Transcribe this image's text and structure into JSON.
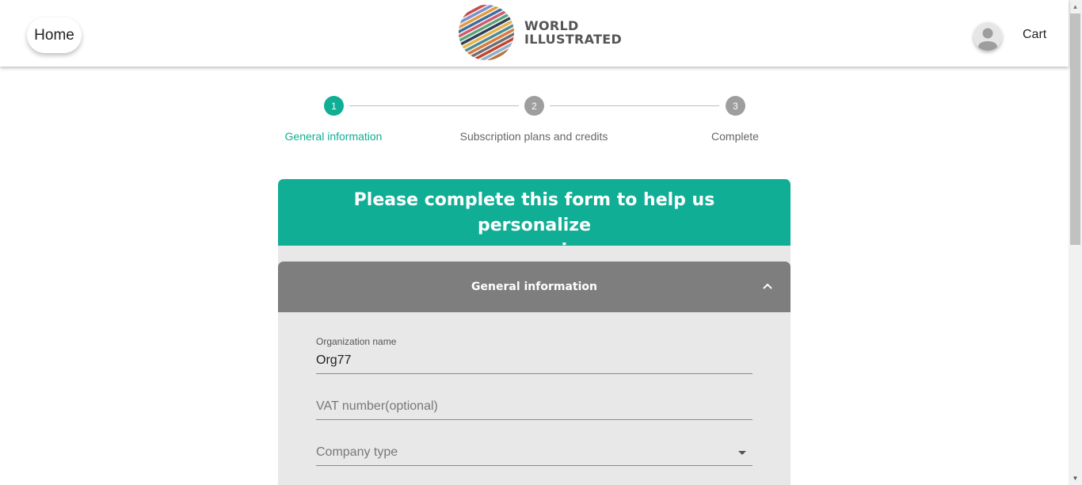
{
  "header": {
    "home_label": "Home",
    "logo_line1": "WORLD",
    "logo_line2": "ILLUSTRATED",
    "cart_label": "Cart"
  },
  "stepper": {
    "steps": [
      {
        "number": "1",
        "label": "General information",
        "active": true
      },
      {
        "number": "2",
        "label": "Subscription plans and credits",
        "active": false
      },
      {
        "number": "3",
        "label": "Complete",
        "active": false
      }
    ],
    "active_color": "#10ae95",
    "inactive_color": "#9e9e9e"
  },
  "banner": {
    "line1": "Please complete this form to help us personalize",
    "line2": "your experience",
    "color": "#10ae95"
  },
  "section": {
    "title": "General information",
    "color": "#7e7e7e"
  },
  "form": {
    "org_name_label": "Organization name",
    "org_name_value": "Org77",
    "vat_placeholder": "VAT number(optional)",
    "company_type_placeholder": "Company type"
  },
  "icons": {
    "avatar": "person-icon",
    "section_toggle": "chevron-up-icon",
    "select": "caret-down-icon"
  }
}
